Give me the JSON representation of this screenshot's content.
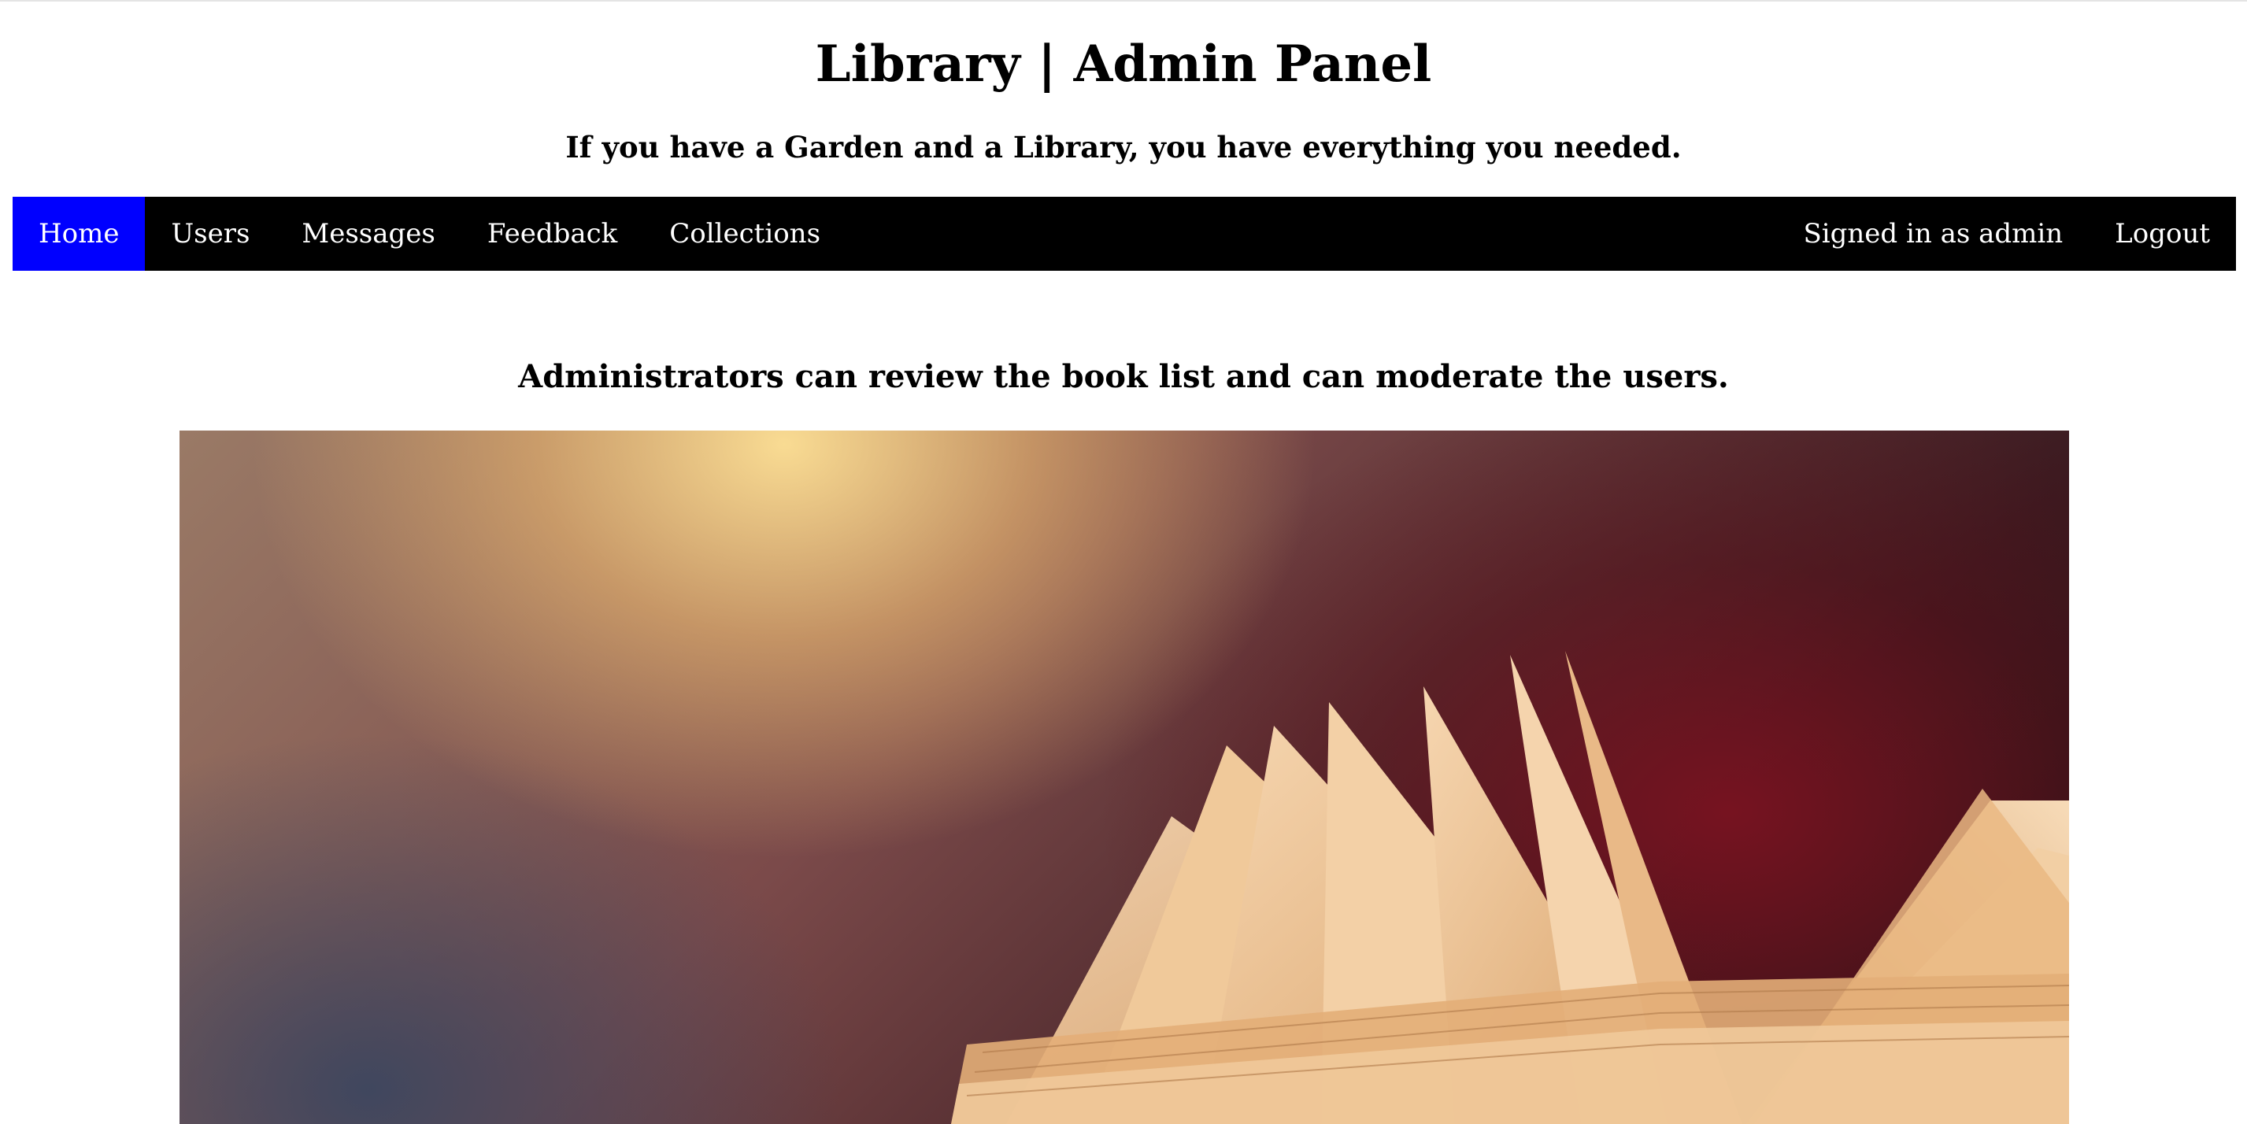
{
  "header": {
    "title": "Library | Admin Panel",
    "tagline": "If you have a Garden and a Library, you have everything you needed."
  },
  "nav": {
    "left_items": [
      {
        "label": "Home",
        "active": true
      },
      {
        "label": "Users",
        "active": false
      },
      {
        "label": "Messages",
        "active": false
      },
      {
        "label": "Feedback",
        "active": false
      },
      {
        "label": "Collections",
        "active": false
      }
    ],
    "right_items": [
      {
        "label": "Signed in as admin"
      },
      {
        "label": "Logout"
      }
    ]
  },
  "main": {
    "intro": "Administrators can review the book list and can moderate the users."
  },
  "colors": {
    "nav_background": "#000000",
    "nav_active": "#0000ff",
    "nav_text": "#ffffff"
  }
}
